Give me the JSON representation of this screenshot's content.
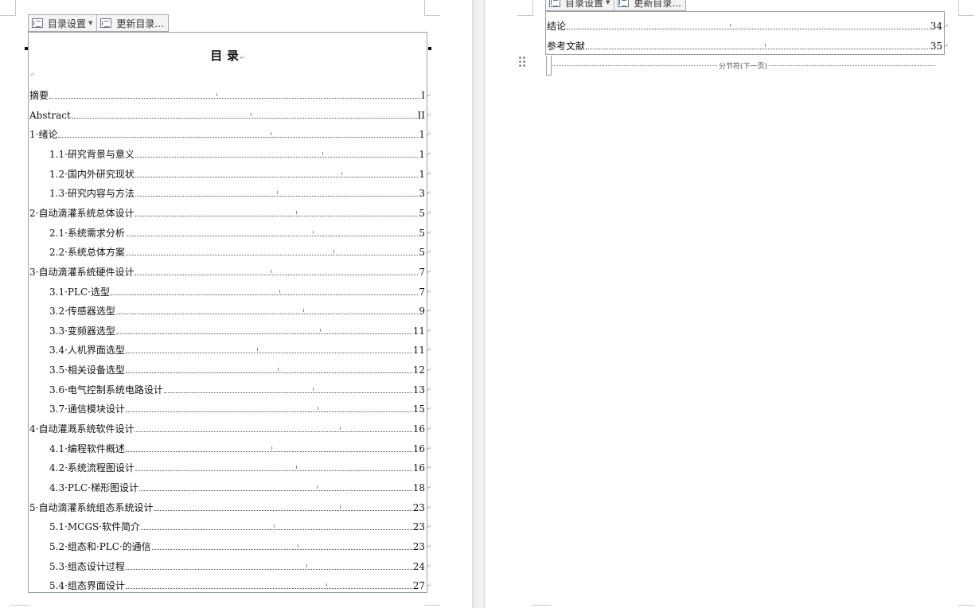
{
  "toolbar": {
    "toc_settings_label": "目录设置",
    "update_toc_label": "更新目录...",
    "toc_icon": "toc-list-icon",
    "update_icon": "toc-update-icon"
  },
  "toc": {
    "title_a": "目",
    "title_spacing": "··",
    "title_b": "录",
    "paragraph_mark": "↵",
    "left_entries": [
      {
        "text": "摘要",
        "page": "I"
      },
      {
        "text": "Abstract",
        "page": "II"
      },
      {
        "text": "1·绪论",
        "page": "1"
      },
      {
        "text": "1.1·研究背景与意义",
        "page": "1"
      },
      {
        "text": "1.2·国内外研究现状",
        "page": "1"
      },
      {
        "text": "1.3·研究内容与方法",
        "page": "3"
      },
      {
        "text": "2·自动滴灌系统总体设计",
        "page": "5"
      },
      {
        "text": "2.1·系统需求分析",
        "page": "5"
      },
      {
        "text": "2.2·系统总体方案",
        "page": "5"
      },
      {
        "text": "3·自动滴灌系统硬件设计",
        "page": "7"
      },
      {
        "text": "3.1·PLC·选型",
        "page": "7"
      },
      {
        "text": "3.2·传感器选型",
        "page": "9"
      },
      {
        "text": "3.3·变频器选型",
        "page": "11"
      },
      {
        "text": "3.4·人机界面选型",
        "page": "11"
      },
      {
        "text": "3.5·相关设备选型",
        "page": "12"
      },
      {
        "text": "3.6·电气控制系统电路设计",
        "page": "13"
      },
      {
        "text": "3.7·通信模块设计",
        "page": "15"
      },
      {
        "text": "4·自动灌溉系统软件设计",
        "page": "16"
      },
      {
        "text": "4.1·编程软件概述",
        "page": "16"
      },
      {
        "text": "4.2·系统流程图设计",
        "page": "16"
      },
      {
        "text": "4.3·PLC·梯形图设计",
        "page": "18"
      },
      {
        "text": "5·自动滴灌系统组态系统设计",
        "page": "23"
      },
      {
        "text": "5.1·MCGS·软件简介",
        "page": "23"
      },
      {
        "text": "5.2·组态和·PLC·的通信",
        "page": "23"
      },
      {
        "text": "5.3·组态设计过程",
        "page": "24"
      },
      {
        "text": "5.4·组态界面设计",
        "page": "27"
      }
    ],
    "right_entries": [
      {
        "text": "结论",
        "page": "34"
      },
      {
        "text": "参考文献",
        "page": "35"
      }
    ]
  },
  "section_break": {
    "label": "分节符(下一页)"
  }
}
